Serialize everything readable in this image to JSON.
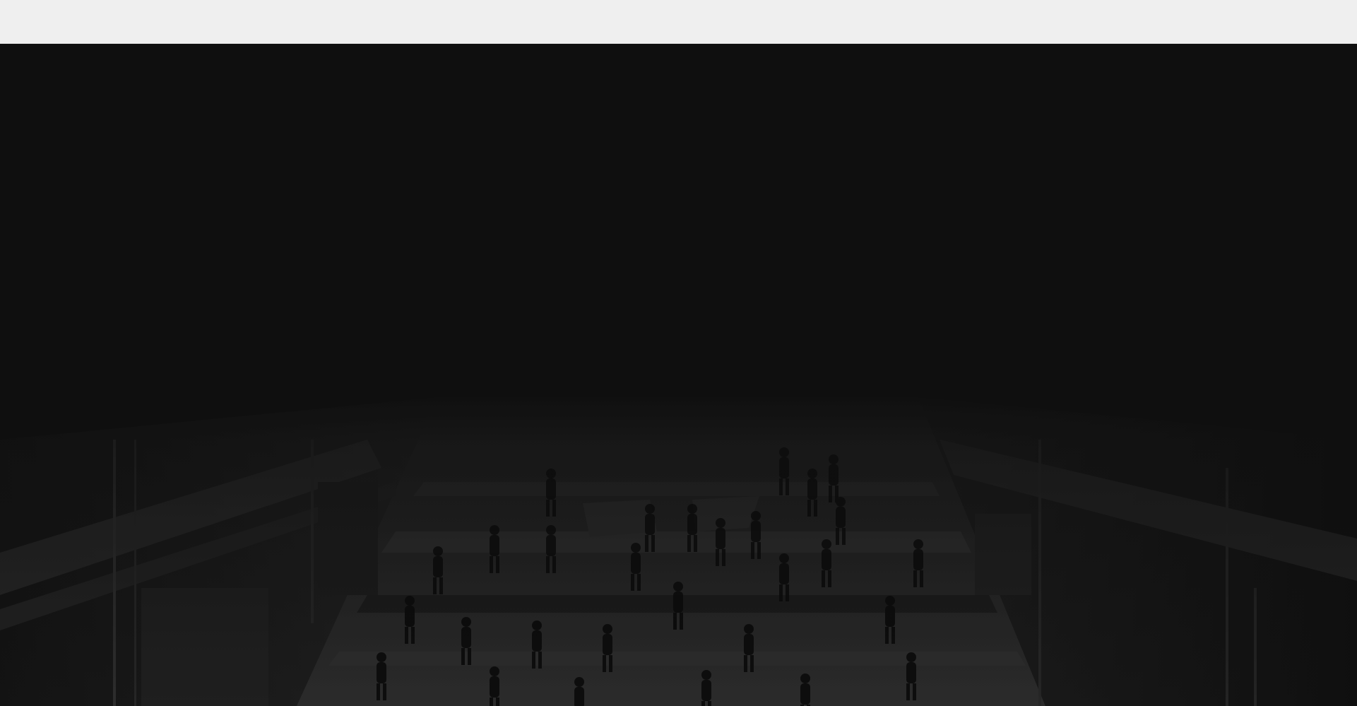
{
  "top_bar": {
    "background": "#efefef"
  },
  "hero": {
    "background": "#141414",
    "image_description": "",
    "image_icon": "crowd-photo-icon"
  }
}
